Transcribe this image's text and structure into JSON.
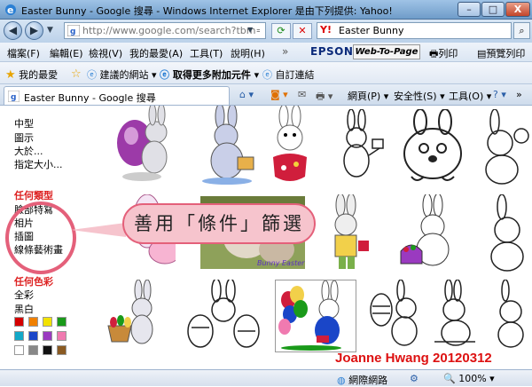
{
  "window": {
    "title": "Easter Bunny - Google 搜尋 - Windows Internet Explorer 是由下列提供: Yahoo!",
    "min_label": "–",
    "max_label": "□",
    "close_label": "X"
  },
  "address": {
    "url": "http://www.google.com/search?tbm=isch&hl",
    "search_value": "Easter Bunny",
    "search_brand": "Y!"
  },
  "menu": {
    "items": [
      "檔案(F)",
      "編輯(E)",
      "檢視(V)",
      "我的最愛(A)",
      "工具(T)",
      "說明(H)"
    ],
    "epson": "EPSON",
    "webtopage": "Web-To-Page",
    "print": "列印",
    "preview": "預覽列印"
  },
  "favorites": {
    "my_favorites": "我的最愛",
    "suggested": "建議的網站",
    "addons": "取得更多附加元件",
    "custom": "自訂連結"
  },
  "tab": {
    "label": "Easter Bunny - Google 搜尋"
  },
  "toolbar": {
    "page": "網頁(P)",
    "safety": "安全性(S)",
    "tools": "工具(O)"
  },
  "sidebar": {
    "size_items": [
      "中型",
      "圖示",
      "大於...",
      "指定大小..."
    ],
    "type_heading": "任何類型",
    "type_items": [
      "臉部特寫",
      "相片",
      "插圖",
      "線條藝術畫"
    ],
    "color_heading": "任何色彩",
    "color_items": [
      "全彩",
      "黑白"
    ],
    "swatches": [
      "#d40000",
      "#f08000",
      "#f2e200",
      "#1a9a1a",
      "#13a8c8",
      "#1a46c8",
      "#9a3ac0",
      "#f07ab0",
      "#ffffff",
      "#888888",
      "#111111",
      "#8a5a22"
    ]
  },
  "callout": {
    "text": "善用「條件」篩選"
  },
  "signature": "Joanne Hwang 20120312",
  "status": {
    "zone": "網際網路",
    "zoom": "100%"
  },
  "colors": {
    "accent_pink": "#e4607a",
    "bubble_fill": "#f6c4cd",
    "sidebar_heading": "#d22222",
    "signature": "#d11111"
  }
}
